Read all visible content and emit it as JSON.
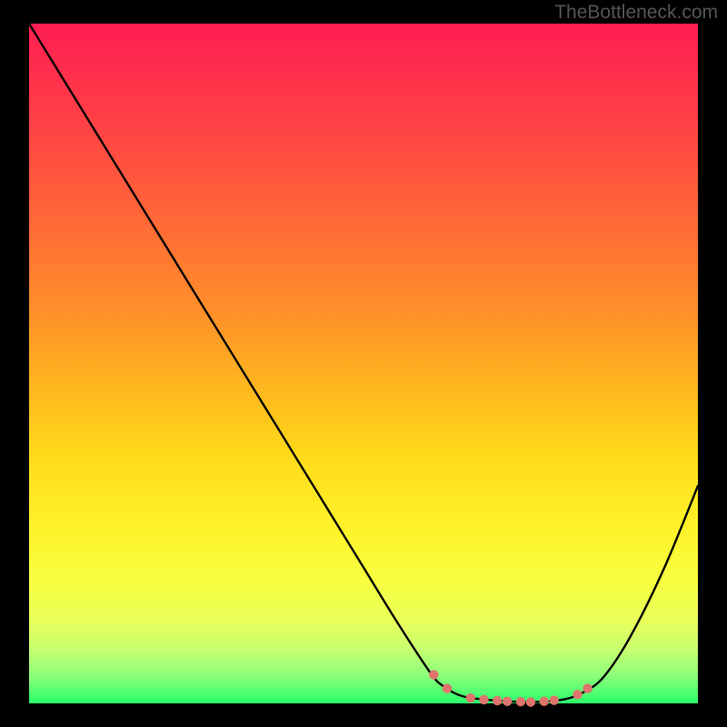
{
  "watermark": "TheBottleneck.com",
  "chart_data": {
    "type": "line",
    "title": "",
    "xlabel": "",
    "ylabel": "",
    "xlim": [
      0,
      100
    ],
    "ylim": [
      0,
      100
    ],
    "series": [
      {
        "name": "bottleneck-curve",
        "x": [
          0,
          5,
          10,
          15,
          20,
          25,
          30,
          35,
          40,
          45,
          50,
          55,
          60,
          62,
          65,
          70,
          75,
          80,
          83,
          86,
          90,
          95,
          100
        ],
        "values": [
          100,
          92,
          84,
          76,
          68,
          60,
          52,
          44,
          36,
          28,
          20,
          12,
          4.5,
          2.5,
          1.0,
          0.4,
          0.2,
          0.6,
          1.7,
          4,
          10,
          20,
          32
        ]
      }
    ],
    "markers": {
      "name": "highlight-dots",
      "color": "#e0736c",
      "points": [
        {
          "x": 60.5,
          "y": 4.2
        },
        {
          "x": 62.5,
          "y": 2.2
        },
        {
          "x": 66,
          "y": 0.8
        },
        {
          "x": 68,
          "y": 0.55
        },
        {
          "x": 70,
          "y": 0.4
        },
        {
          "x": 71.5,
          "y": 0.3
        },
        {
          "x": 73.5,
          "y": 0.25
        },
        {
          "x": 75,
          "y": 0.2
        },
        {
          "x": 77,
          "y": 0.3
        },
        {
          "x": 78.5,
          "y": 0.45
        },
        {
          "x": 82,
          "y": 1.3
        },
        {
          "x": 83.5,
          "y": 2.2
        }
      ]
    }
  }
}
